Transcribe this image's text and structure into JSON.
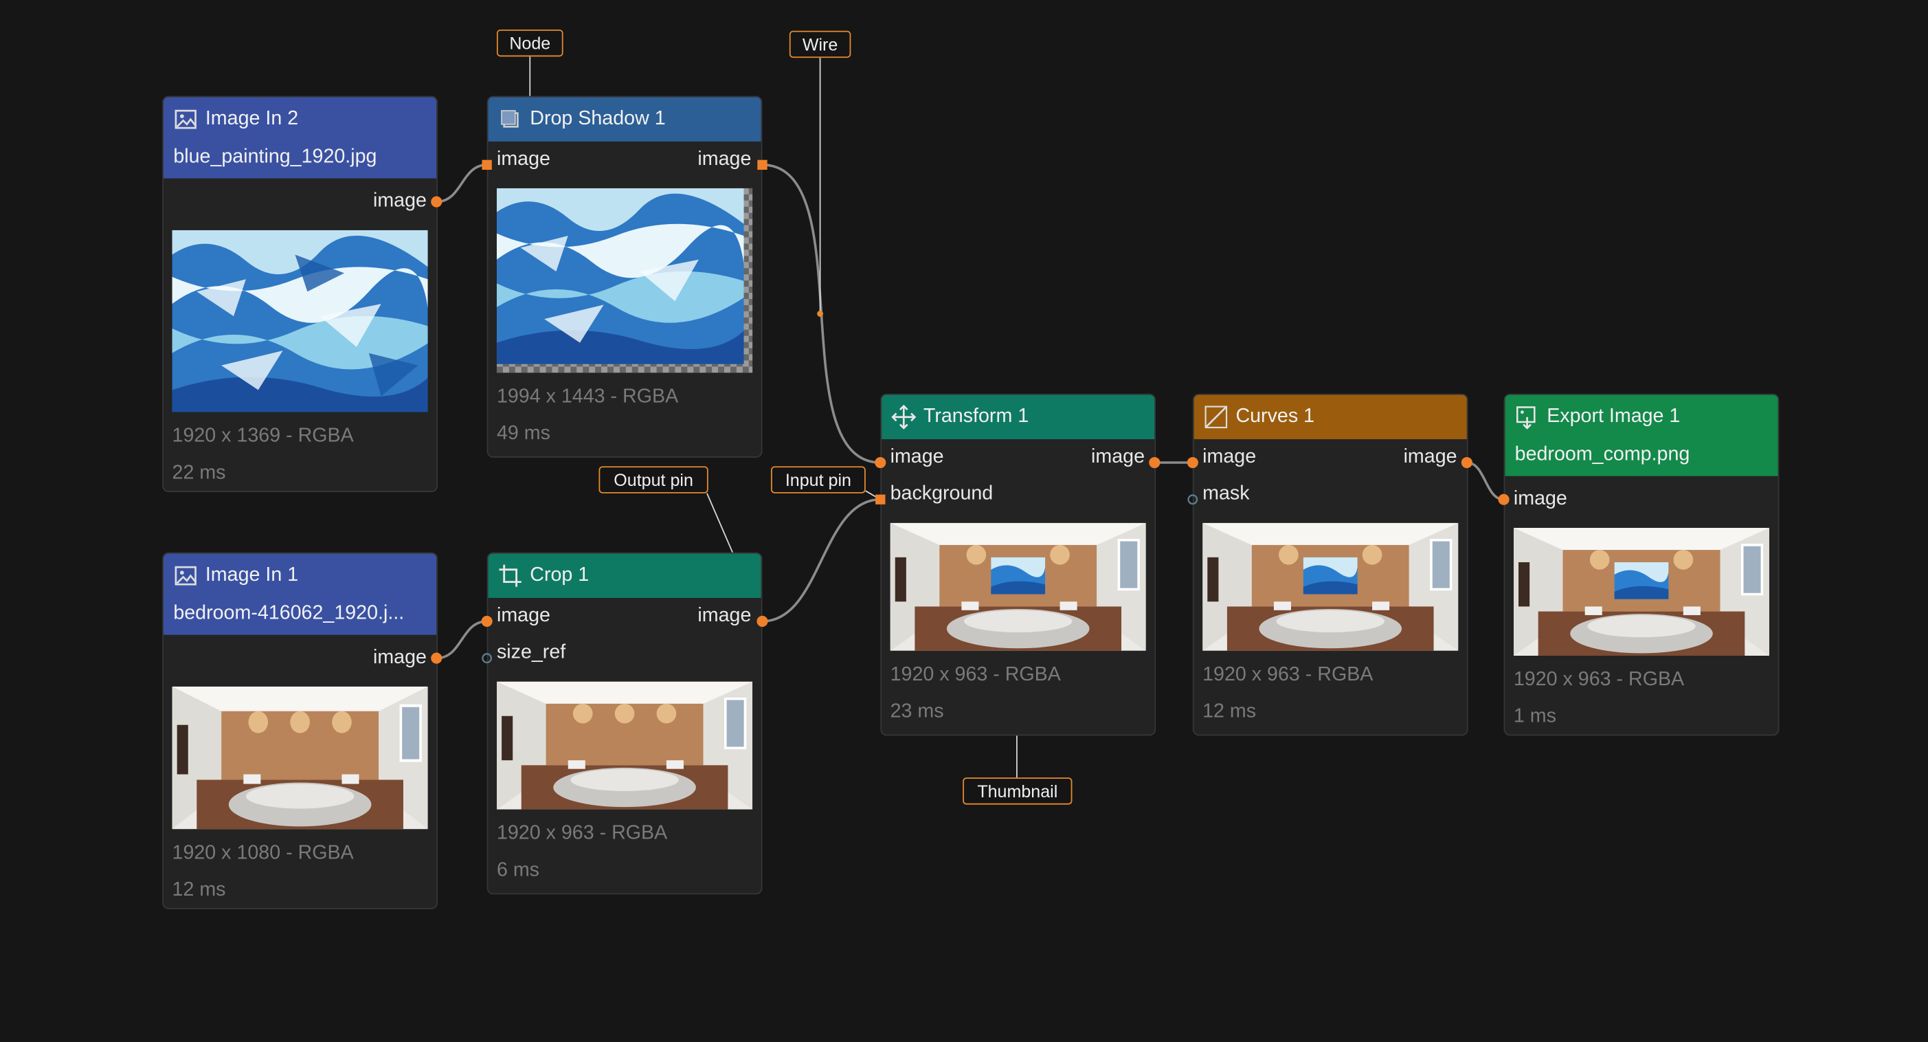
{
  "colors": {
    "background": "#161616",
    "node_body": "#232323",
    "pin_orange": "#f0812a",
    "wire": "#8c8c8c",
    "callout_border": "#e6892e",
    "header_image_in": "#3a51a2",
    "header_drop_shadow": "#2c5f96",
    "header_teal": "#0f7a64",
    "header_curves": "#9b5d0d",
    "header_export": "#13894a"
  },
  "nodes": {
    "image_in_2": {
      "title": "Image In 2",
      "icon": "image-icon",
      "subtitle": "blue_painting_1920.jpg",
      "output": "image",
      "thumbnail": "blue-painting",
      "dims": "1920 x 1369  -  RGBA",
      "time": "22 ms"
    },
    "drop_shadow_1": {
      "title": "Drop Shadow 1",
      "icon": "square-icon",
      "input": "image",
      "output": "image",
      "thumbnail": "blue-painting-shadow",
      "dims": "1994 x 1443  -  RGBA",
      "time": "49 ms"
    },
    "image_in_1": {
      "title": "Image In 1",
      "icon": "image-icon",
      "subtitle": "bedroom-416062_1920.j...",
      "output": "image",
      "thumbnail": "bedroom",
      "dims": "1920 x 1080  -  RGBA",
      "time": "12 ms"
    },
    "crop_1": {
      "title": "Crop 1",
      "icon": "crop-icon",
      "inputs": [
        "image",
        "size_ref"
      ],
      "output": "image",
      "thumbnail": "bedroom",
      "dims": "1920 x 963  -  RGBA",
      "time": "6 ms"
    },
    "transform_1": {
      "title": "Transform 1",
      "icon": "move-icon",
      "inputs": [
        "image",
        "background"
      ],
      "output": "image",
      "thumbnail": "bedroom-with-painting",
      "dims": "1920 x 963  -  RGBA",
      "time": "23 ms"
    },
    "curves_1": {
      "title": "Curves 1",
      "icon": "curve-icon",
      "inputs": [
        "image",
        "mask"
      ],
      "output": "image",
      "thumbnail": "bedroom-with-painting",
      "dims": "1920 x 963  -  RGBA",
      "time": "12 ms"
    },
    "export_image_1": {
      "title": "Export Image 1",
      "icon": "export-icon",
      "subtitle": "bedroom_comp.png",
      "input": "image",
      "thumbnail": "bedroom-with-painting",
      "dims": "1920 x 963  -  RGBA",
      "time": "1 ms"
    }
  },
  "callouts": {
    "node": "Node",
    "wire": "Wire",
    "output_pin": "Output pin",
    "input_pin": "Input pin",
    "thumbnail": "Thumbnail"
  }
}
